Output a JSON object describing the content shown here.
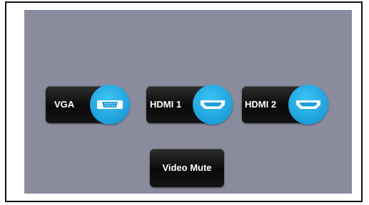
{
  "sources": [
    {
      "label": "VGA",
      "icon": "vga-port-icon"
    },
    {
      "label": "HDMI 1",
      "icon": "hdmi-port-icon"
    },
    {
      "label": "HDMI 2",
      "icon": "hdmi-port-icon"
    }
  ],
  "video_mute": {
    "label": "Video Mute"
  },
  "colors": {
    "panel_background": "#8a8c9e",
    "button_background": "#111111",
    "icon_circle": "#22a6e0"
  }
}
